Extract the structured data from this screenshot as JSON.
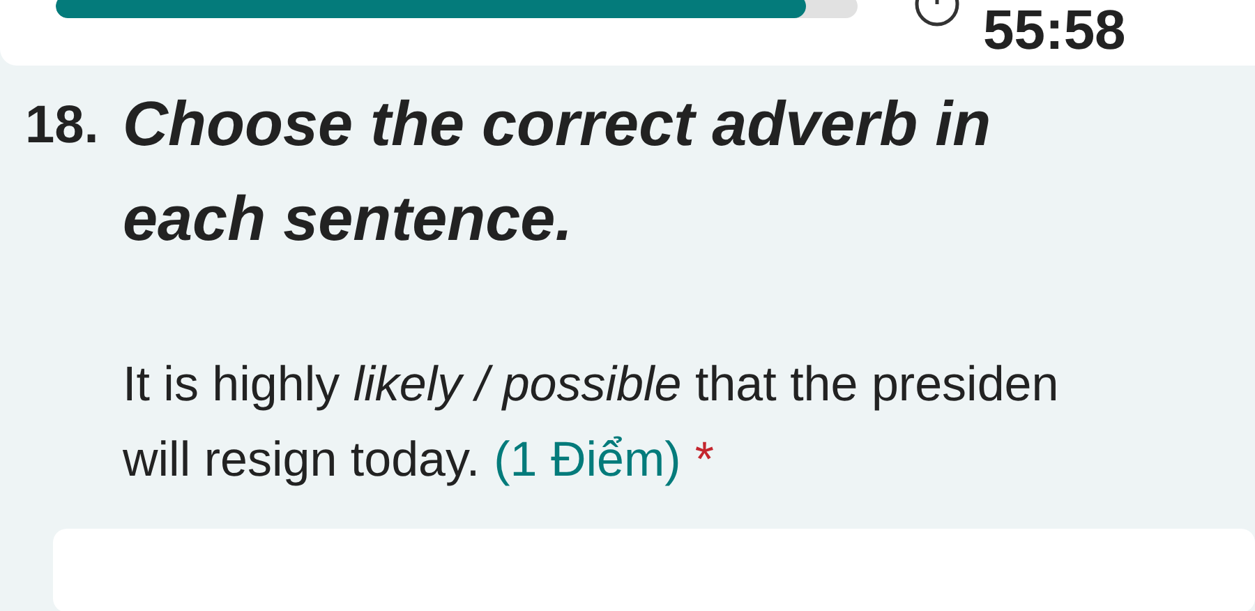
{
  "progress": {
    "level": 0.935
  },
  "timer": {
    "time": "55:58"
  },
  "question": {
    "number": "18.",
    "title": "Choose the correct adverb in each sentence.",
    "lines": [
      "It is highly *likely / possible* that the presiden",
      "will resign today."
    ],
    "points": "(1 Điểm)",
    "required": "*"
  }
}
